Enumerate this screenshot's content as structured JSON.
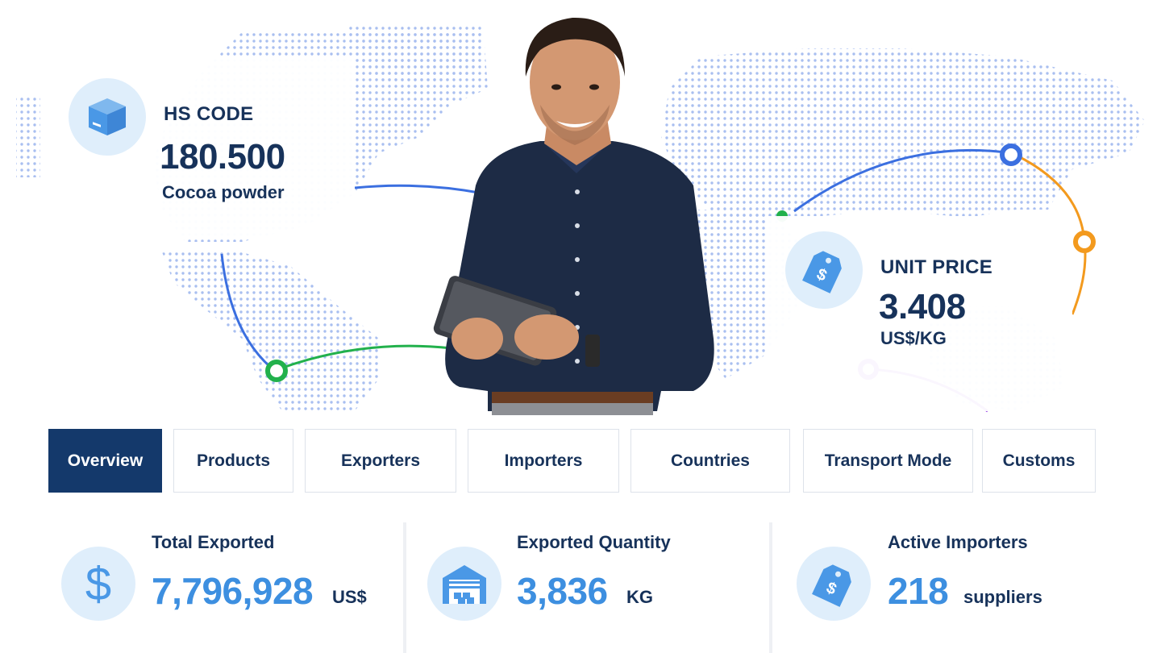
{
  "hs_card": {
    "label": "HS CODE",
    "value": "180.500",
    "description": "Cocoa powder",
    "icon": "box-icon"
  },
  "price_card": {
    "label": "UNIT PRICE",
    "value": "3.408",
    "unit": "US$/KG",
    "icon": "price-tag-icon"
  },
  "tabs": [
    {
      "label": "Overview",
      "active": true
    },
    {
      "label": "Products",
      "active": false
    },
    {
      "label": "Exporters",
      "active": false
    },
    {
      "label": "Importers",
      "active": false
    },
    {
      "label": "Countries",
      "active": false
    },
    {
      "label": "Transport Mode",
      "active": false
    },
    {
      "label": "Customs",
      "active": false
    }
  ],
  "stats": {
    "total_exported": {
      "title": "Total Exported",
      "value": "7,796,928",
      "unit": "US$",
      "icon": "dollar-icon"
    },
    "exported_quantity": {
      "title": "Exported Quantity",
      "value": "3,836",
      "unit": "KG",
      "icon": "warehouse-icon"
    },
    "active_importers": {
      "title": "Active Importers",
      "value": "218",
      "unit": "suppliers",
      "icon": "price-tag-icon"
    }
  },
  "colors": {
    "navy": "#17325a",
    "active_tab": "#14396b",
    "accent_blue": "#3d8fe0",
    "icon_bg": "#dfeefb",
    "route_blue": "#3b6fe0",
    "route_green": "#22b14c",
    "route_orange": "#f39a1e",
    "route_purple": "#8a2be2"
  }
}
